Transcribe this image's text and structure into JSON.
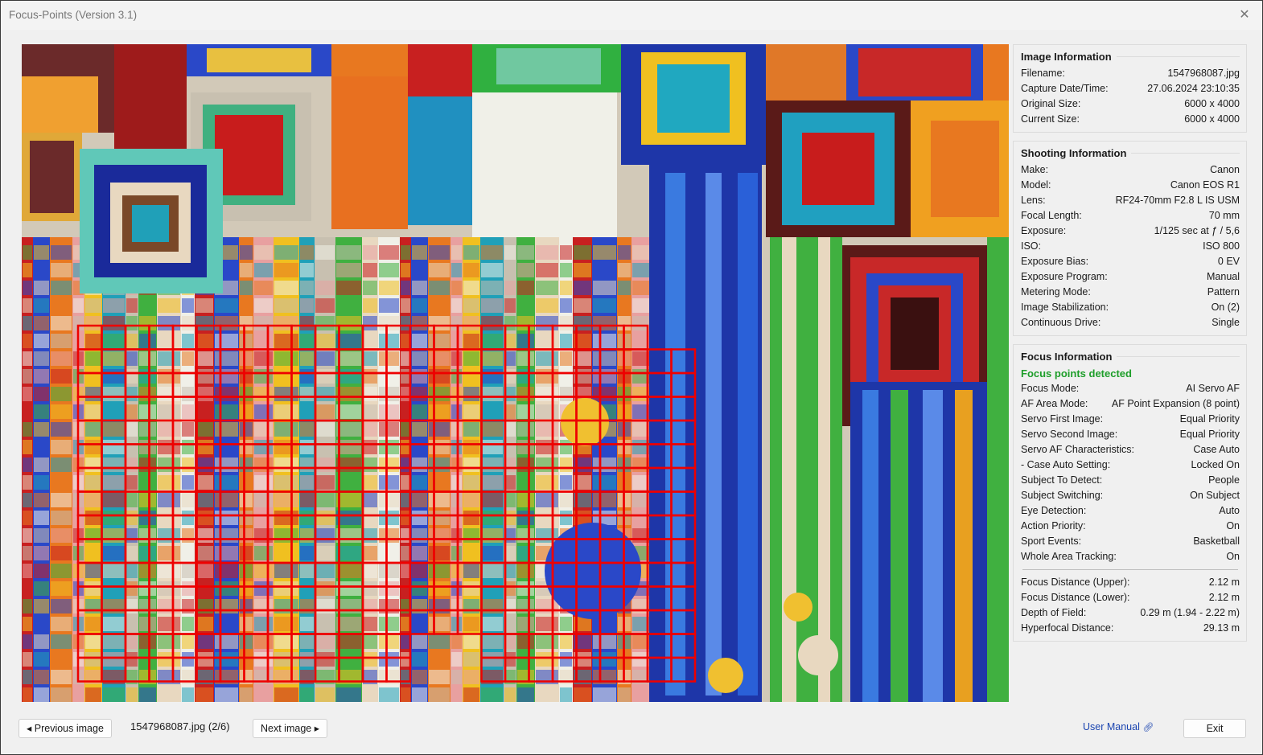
{
  "window": {
    "title": "Focus-Points (Version 3.1)",
    "close_icon": "close-icon"
  },
  "image_info": {
    "title": "Image Information",
    "rows": [
      {
        "label": "Filename:",
        "value": "1547968087.jpg"
      },
      {
        "label": "Capture Date/Time:",
        "value": "27.06.2024 23:10:35"
      },
      {
        "label": "Original Size:",
        "value": "6000 x 4000"
      },
      {
        "label": "Current Size:",
        "value": "6000 x 4000"
      }
    ]
  },
  "shooting_info": {
    "title": "Shooting Information",
    "rows": [
      {
        "label": "Make:",
        "value": "Canon"
      },
      {
        "label": "Model:",
        "value": "Canon EOS R1"
      },
      {
        "label": "Lens:",
        "value": "RF24-70mm F2.8 L IS USM"
      },
      {
        "label": "Focal Length:",
        "value": "70 mm"
      },
      {
        "label": "Exposure:",
        "value": "1/125 sec at ƒ / 5,6"
      },
      {
        "label": "ISO:",
        "value": "ISO 800"
      },
      {
        "label": "Exposure Bias:",
        "value": "0 EV"
      },
      {
        "label": "Exposure Program:",
        "value": "Manual"
      },
      {
        "label": "Metering Mode:",
        "value": "Pattern"
      },
      {
        "label": "Image Stabilization:",
        "value": "On (2)"
      },
      {
        "label": "Continuous Drive:",
        "value": "Single"
      }
    ]
  },
  "focus_info": {
    "title": "Focus Information",
    "status": "Focus points detected",
    "status_color": "#1e9e2a",
    "rows": [
      {
        "label": "Focus Mode:",
        "value": "AI Servo AF"
      },
      {
        "label": "AF Area Mode:",
        "value": "AF Point Expansion (8 point)"
      },
      {
        "label": "Servo First Image:",
        "value": "Equal Priority"
      },
      {
        "label": "Servo Second Image:",
        "value": "Equal Priority"
      },
      {
        "label": "Servo AF Characteristics:",
        "value": "Case Auto"
      },
      {
        "label": "- Case Auto Setting:",
        "value": "Locked On"
      },
      {
        "label": "Subject To Detect:",
        "value": "People"
      },
      {
        "label": "Subject Switching:",
        "value": "On Subject"
      },
      {
        "label": "Eye Detection:",
        "value": "Auto"
      },
      {
        "label": "Action Priority:",
        "value": "On"
      },
      {
        "label": "Sport Events:",
        "value": "Basketball"
      },
      {
        "label": "Whole Area Tracking:",
        "value": "On"
      }
    ],
    "distance_rows": [
      {
        "label": "Focus Distance (Upper):",
        "value": "2.12 m"
      },
      {
        "label": "Focus Distance (Lower):",
        "value": "2.12 m"
      },
      {
        "label": "Depth of Field:",
        "value": "0.29 m (1.94 - 2.22 m)"
      },
      {
        "label": "Hyperfocal Distance:",
        "value": "29.13 m"
      }
    ]
  },
  "footer": {
    "prev_label": "◂ Previous image",
    "file_label": "1547968087.jpg (2/6)",
    "next_label": "Next image ▸",
    "manual_label": "User Manual",
    "manual_icon": "external-link-icon",
    "exit_label": "Exit"
  },
  "colors": {
    "focus_point": "#ee0000",
    "link": "#1a44b0"
  }
}
